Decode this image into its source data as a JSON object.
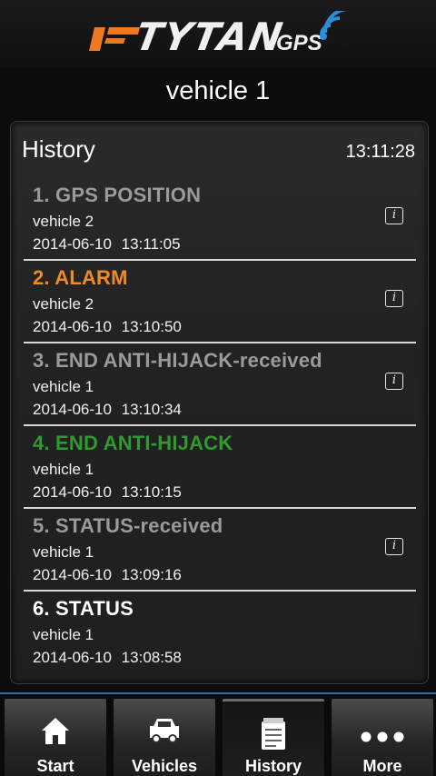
{
  "brand": {
    "name": "TYTAN",
    "suffix": "GPS",
    "accent": "#f07820"
  },
  "header": {
    "title": "vehicle 1"
  },
  "history": {
    "title": "History",
    "time": "13:11:28",
    "items": [
      {
        "title": "1. GPS POSITION",
        "vehicle": "vehicle 2",
        "date": "2014-06-10  13:11:05",
        "color": "#9a9a9a",
        "info": true
      },
      {
        "title": "2. ALARM",
        "vehicle": "vehicle 2",
        "date": "2014-06-10  13:10:50",
        "color": "#f08a24",
        "info": true
      },
      {
        "title": "3. END ANTI-HIJACK-received",
        "vehicle": "vehicle 1",
        "date": "2014-06-10  13:10:34",
        "color": "#9a9a9a",
        "info": true
      },
      {
        "title": "4. END ANTI-HIJACK",
        "vehicle": "vehicle 1",
        "date": "2014-06-10  13:10:15",
        "color": "#2f9a2f",
        "info": false
      },
      {
        "title": "5. STATUS-received",
        "vehicle": "vehicle 1",
        "date": "2014-06-10  13:09:16",
        "color": "#9a9a9a",
        "info": true
      },
      {
        "title": "6. STATUS",
        "vehicle": "vehicle 1",
        "date": "2014-06-10  13:08:58",
        "color": "#ffffff",
        "info": false
      }
    ],
    "info_glyph": "i"
  },
  "tabs": [
    {
      "label": "Start",
      "icon": "home-icon"
    },
    {
      "label": "Vehicles",
      "icon": "car-icon"
    },
    {
      "label": "History",
      "icon": "notepad-icon",
      "active": true
    },
    {
      "label": "More",
      "icon": "more-dots-icon"
    }
  ]
}
